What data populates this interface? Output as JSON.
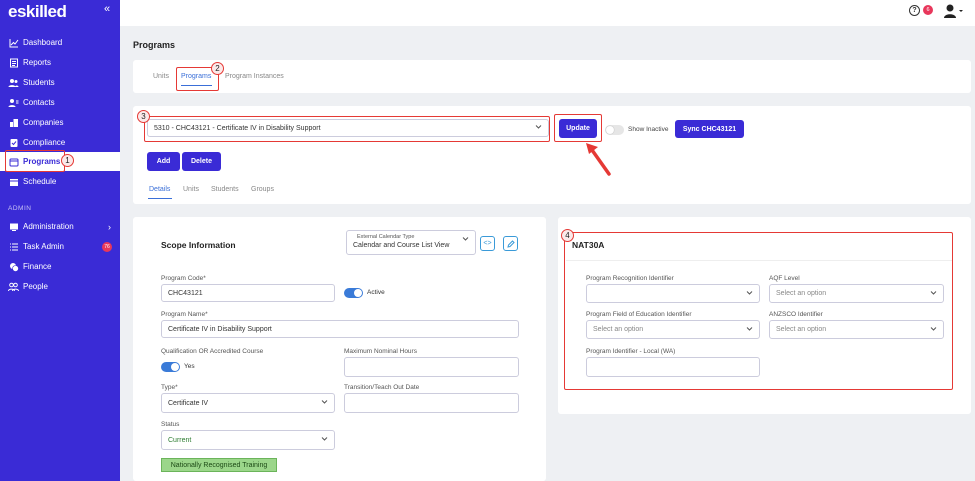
{
  "app": {
    "logo": "eskilled"
  },
  "sidebar": {
    "items": [
      {
        "label": "Dashboard",
        "icon": "chart-line-icon"
      },
      {
        "label": "Reports",
        "icon": "report-icon"
      },
      {
        "label": "Students",
        "icon": "users-icon"
      },
      {
        "label": "Contacts",
        "icon": "contacts-icon"
      },
      {
        "label": "Companies",
        "icon": "building-icon"
      },
      {
        "label": "Compliance",
        "icon": "compliance-icon"
      },
      {
        "label": "Programs",
        "icon": "program-icon"
      },
      {
        "label": "Schedule",
        "icon": "calendar-icon"
      }
    ],
    "section_admin": "ADMIN",
    "admin_items": [
      {
        "label": "Administration",
        "icon": "admin-icon"
      },
      {
        "label": "Task Admin",
        "icon": "task-icon",
        "badge": "76"
      },
      {
        "label": "Finance",
        "icon": "finance-icon"
      },
      {
        "label": "People",
        "icon": "people-icon"
      }
    ]
  },
  "topbar": {
    "notification_count": "6"
  },
  "page": {
    "title": "Programs"
  },
  "tabs": {
    "units": "Units",
    "programs": "Programs",
    "instances": "Program Instances"
  },
  "program_select": {
    "value": "5310 - CHC43121 - Certificate IV in Disability Support"
  },
  "buttons": {
    "update": "Update",
    "show_inactive": "Show Inactive",
    "sync": "Sync CHC43121",
    "add": "Add",
    "delete": "Delete"
  },
  "subtabs": {
    "details": "Details",
    "units": "Units",
    "students": "Students",
    "groups": "Groups"
  },
  "scope": {
    "title": "Scope Information",
    "calendar_label": "External Calendar Type",
    "calendar_value": "Calendar and Course List View",
    "program_code_label": "Program Code*",
    "program_code": "CHC43121",
    "active_label": "Active",
    "program_name_label": "Program Name*",
    "program_name": "Certificate IV in Disability Support",
    "qualification_label": "Qualification OR Accredited Course",
    "qualification_value": "Yes",
    "max_hours_label": "Maximum Nominal Hours",
    "type_label": "Type*",
    "type_value": "Certificate IV",
    "transition_label": "Transition/Teach Out Date",
    "status_label": "Status",
    "status_value": "Current",
    "nrt": "Nationally Recognised Training"
  },
  "nat": {
    "title": "NAT30A",
    "recognition_label": "Program Recognition Identifier",
    "aqf_label": "AQF Level",
    "aqf_placeholder": "Select an option",
    "field_label": "Program Field of Education Identifier",
    "field_placeholder": "Select an option",
    "anzsco_label": "ANZSCO Identifier",
    "anzsco_placeholder": "Select an option",
    "local_label": "Program Identifier - Local (WA)"
  },
  "annotations": {
    "a1": "1",
    "a2": "2",
    "a3": "3",
    "a4": "4"
  },
  "colors": {
    "brand": "#3a2bd6",
    "annotation": "#e53935",
    "link": "#3a6fd8"
  }
}
